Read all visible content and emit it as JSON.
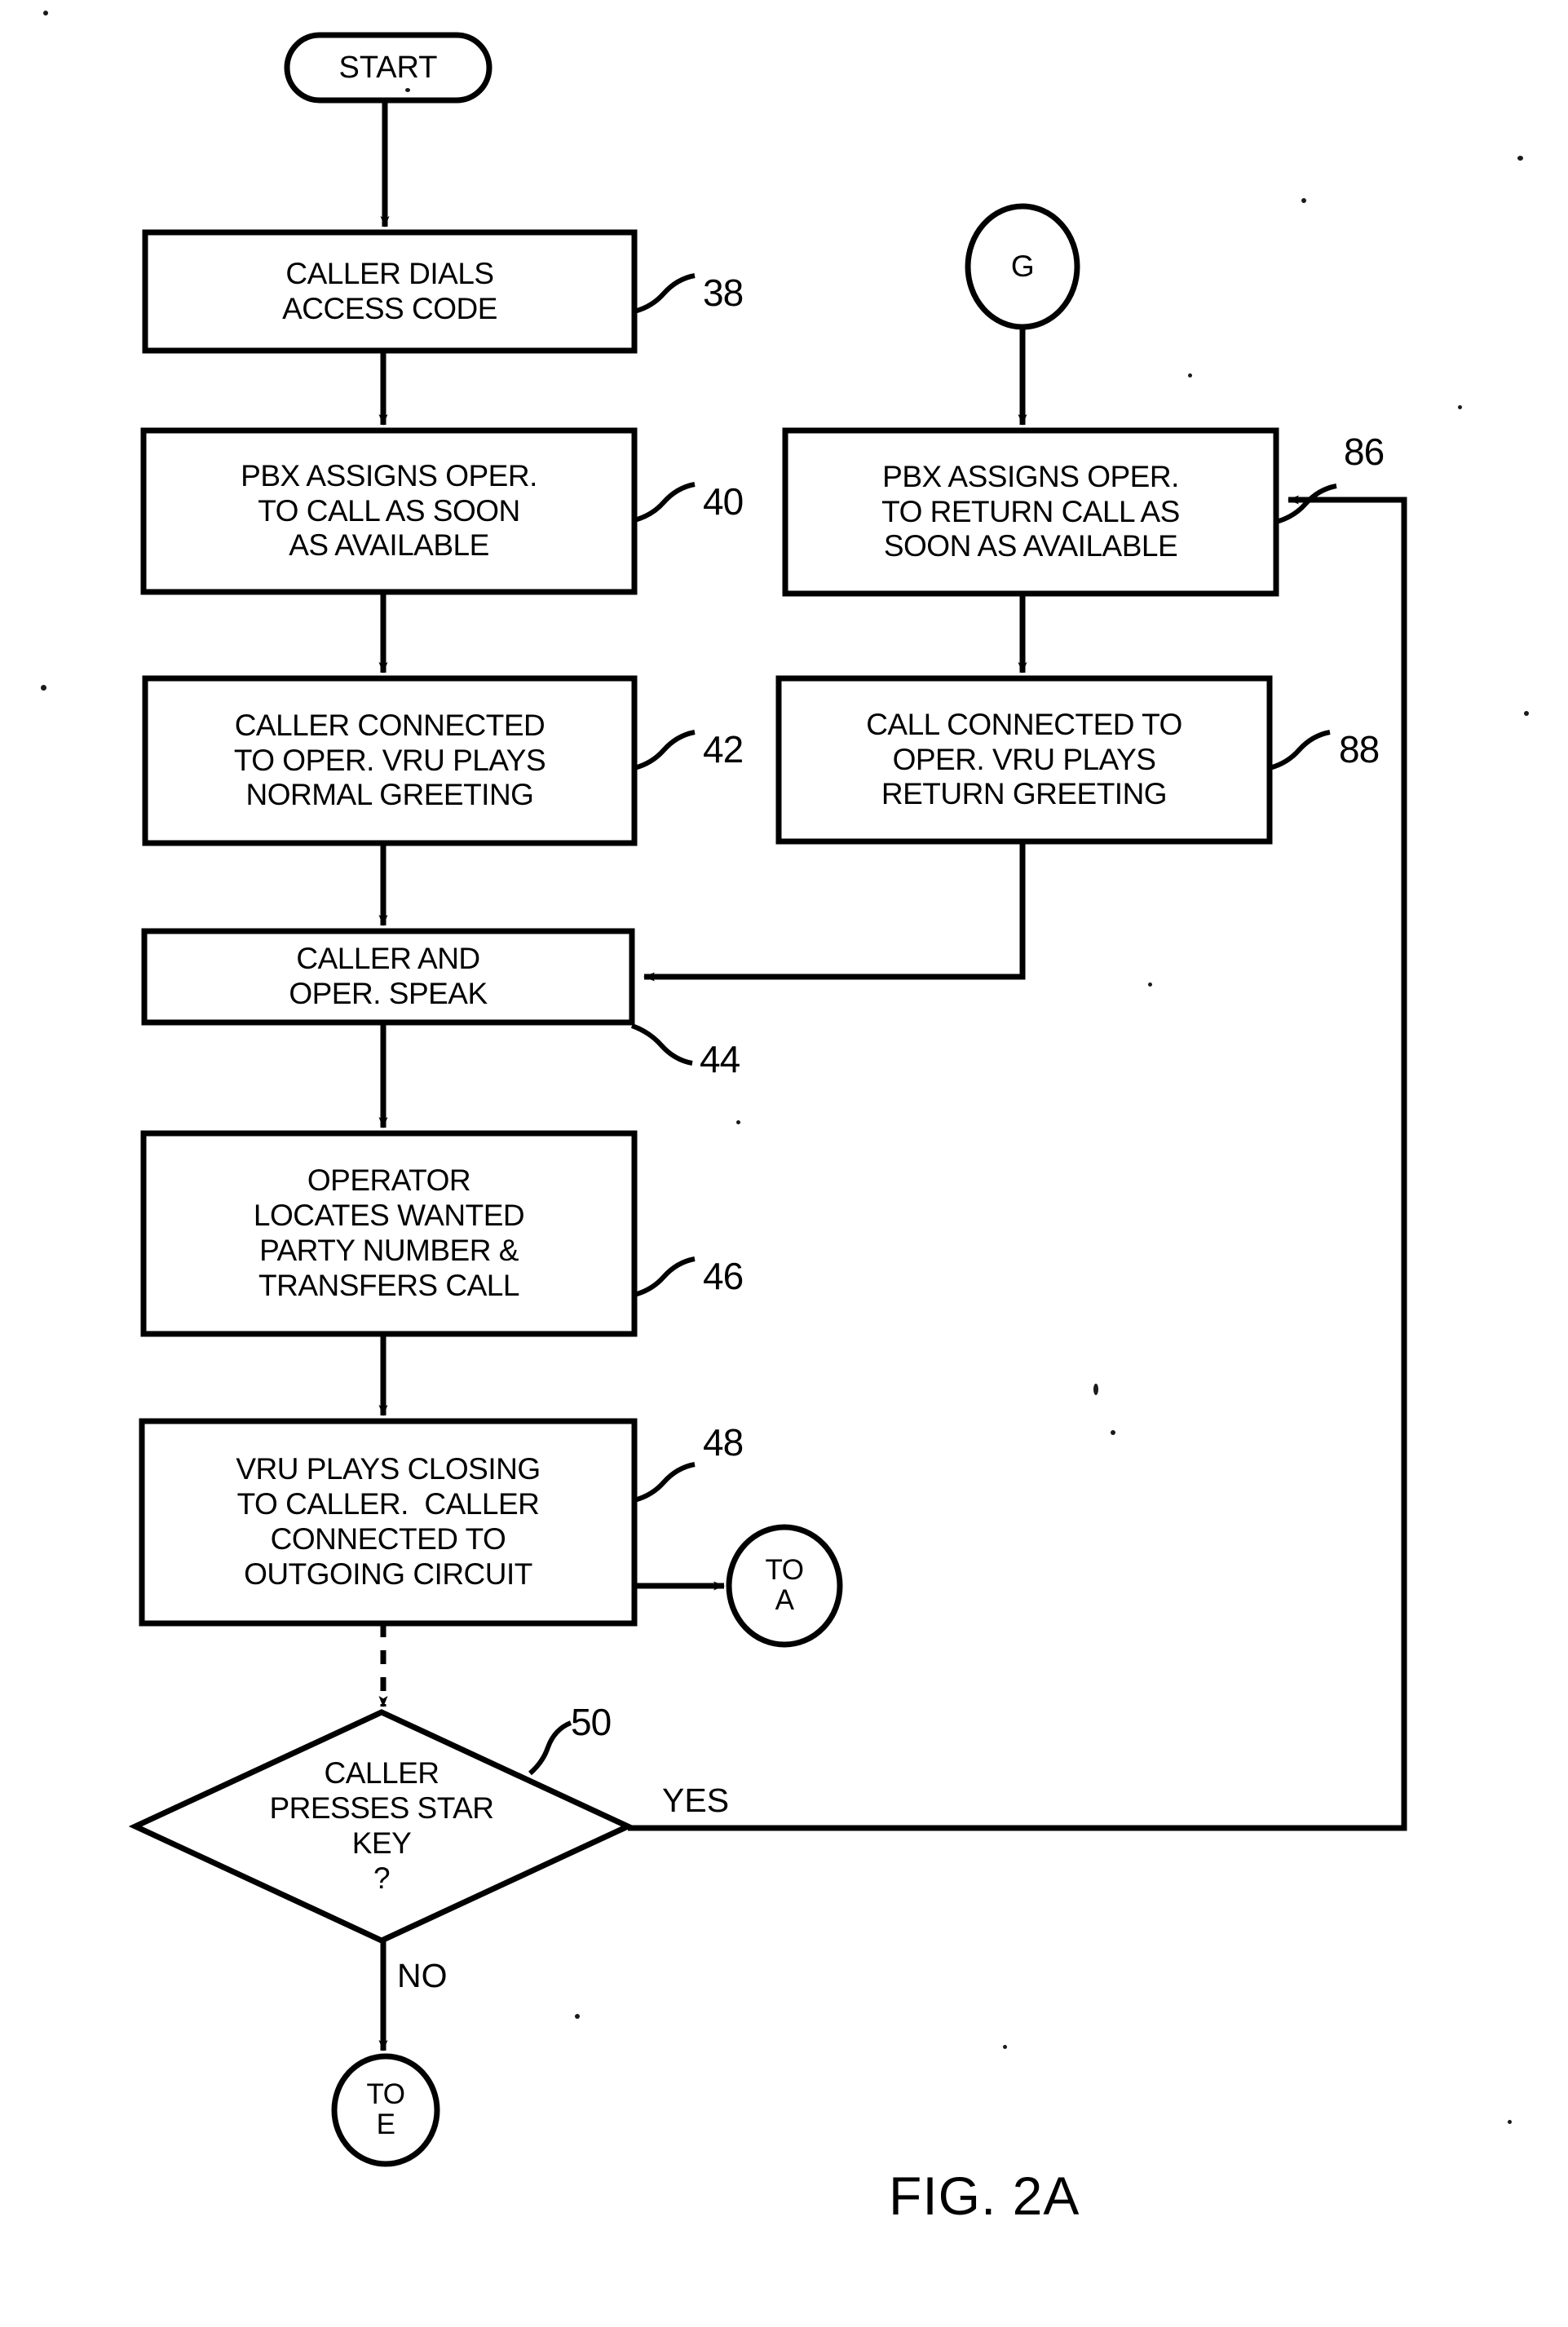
{
  "figure": {
    "caption": "FIG. 2A",
    "type": "patent-flowchart"
  },
  "nodes": {
    "start": {
      "label": "START",
      "shape": "stadium"
    },
    "box38": {
      "lines": [
        "CALLER DIALS",
        "ACCESS CODE"
      ],
      "ref": "38",
      "shape": "process"
    },
    "box40": {
      "lines": [
        "PBX ASSIGNS OPER.",
        "TO CALL AS SOON",
        "AS AVAILABLE"
      ],
      "ref": "40",
      "shape": "process"
    },
    "box42": {
      "lines": [
        "CALLER CONNECTED",
        "TO OPER. VRU PLAYS",
        "NORMAL GREETING"
      ],
      "ref": "42",
      "shape": "process"
    },
    "box44": {
      "lines": [
        "CALLER AND",
        "OPER. SPEAK"
      ],
      "ref": "44",
      "shape": "process"
    },
    "box46": {
      "lines": [
        "OPERATOR",
        "LOCATES WANTED",
        "PARTY NUMBER &",
        "TRANSFERS CALL"
      ],
      "ref": "46",
      "shape": "process"
    },
    "box48": {
      "lines": [
        "VRU PLAYS CLOSING",
        "TO CALLER.  CALLER",
        "CONNECTED TO",
        "OUTGOING CIRCUIT"
      ],
      "ref": "48",
      "shape": "process"
    },
    "diamond50": {
      "lines": [
        "CALLER",
        "PRESSES STAR",
        "KEY",
        "?"
      ],
      "ref": "50",
      "shape": "decision"
    },
    "connG": {
      "label": "G",
      "shape": "circle"
    },
    "connToA": {
      "lines": [
        "TO",
        "A"
      ],
      "shape": "circle"
    },
    "connToE": {
      "lines": [
        "TO",
        "E"
      ],
      "shape": "circle"
    },
    "box86": {
      "lines": [
        "PBX ASSIGNS OPER.",
        "TO RETURN CALL AS",
        "SOON AS AVAILABLE"
      ],
      "ref": "86",
      "shape": "process"
    },
    "box88": {
      "lines": [
        "CALL CONNECTED TO",
        "OPER. VRU PLAYS",
        "RETURN GREETING"
      ],
      "ref": "88",
      "shape": "process"
    }
  },
  "edges": {
    "yes_label": "YES",
    "no_label": "NO"
  },
  "colors": {
    "ink": "#000000",
    "paper": "#ffffff"
  }
}
